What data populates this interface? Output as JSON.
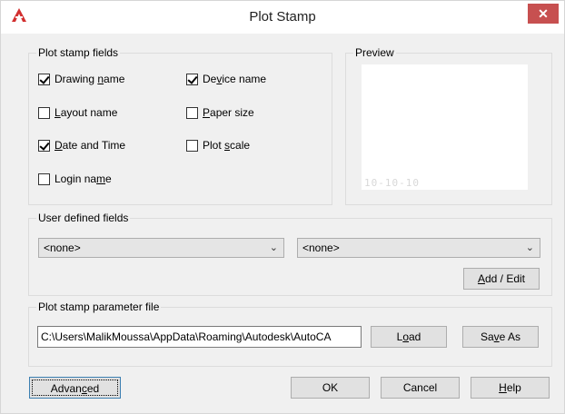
{
  "window": {
    "title": "Plot Stamp",
    "close_glyph": "✕",
    "app_icon": "autocad-logo-icon"
  },
  "fields_group": {
    "title": "Plot stamp fields",
    "items": [
      {
        "label": "Drawing name",
        "checked": true
      },
      {
        "label": "Layout name",
        "checked": false
      },
      {
        "label": "Date and Time",
        "checked": true
      },
      {
        "label": "Login name",
        "checked": false
      },
      {
        "label": "Device name",
        "checked": true
      },
      {
        "label": "Paper size",
        "checked": false
      },
      {
        "label": "Plot scale",
        "checked": false
      }
    ]
  },
  "preview_group": {
    "title": "Preview",
    "sample_text": "10-10-10"
  },
  "user_fields_group": {
    "title": "User defined fields",
    "select1_value": "<none>",
    "select2_value": "<none>",
    "add_edit_label": "Add / Edit"
  },
  "param_file_group": {
    "title": "Plot stamp parameter file",
    "path_value": "C:\\Users\\MalikMoussa\\AppData\\Roaming\\Autodesk\\AutoCA",
    "load_label": "Load",
    "save_as_label": "Save As"
  },
  "footer": {
    "advanced_label": "Advanced",
    "ok_label": "OK",
    "cancel_label": "Cancel",
    "help_label": "Help"
  },
  "colors": {
    "close_button": "#c75050",
    "dialog_bg": "#f0f0f0",
    "focus_border": "#3c7fb1"
  }
}
